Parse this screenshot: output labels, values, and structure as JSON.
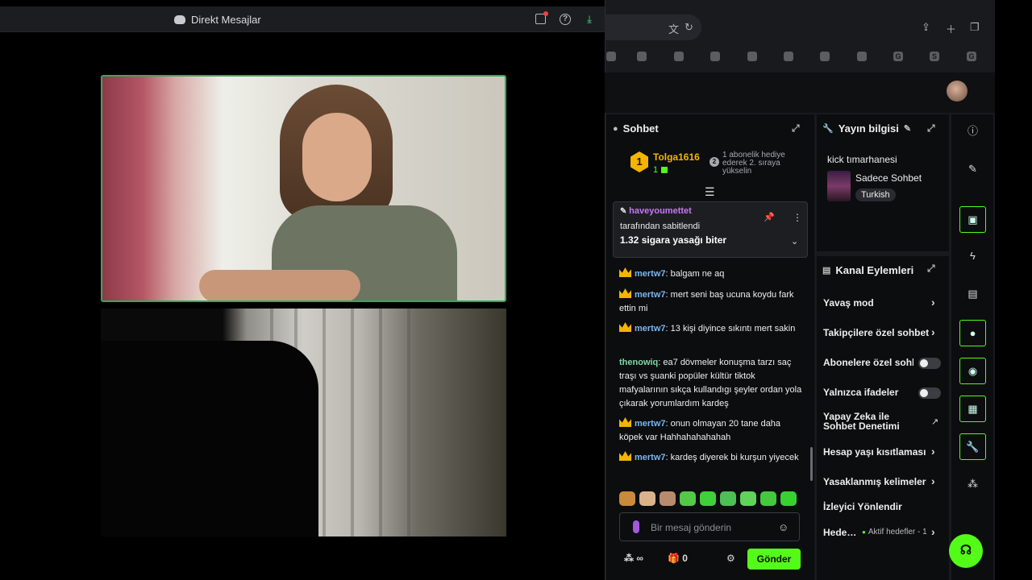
{
  "discord": {
    "window_title": "Direkt Mesajlar",
    "icons": [
      "discord-icon",
      "inbox-icon",
      "help-icon",
      "download-icon"
    ]
  },
  "browser": {
    "icons": [
      "translate-icon",
      "reload-icon",
      "share-icon",
      "new-tab-icon",
      "tabs-icon"
    ],
    "bookmarks": [
      "",
      "",
      "",
      "",
      "",
      "",
      "",
      "",
      "G",
      "S",
      "G"
    ]
  },
  "chat": {
    "header": "Sohbet",
    "leaderboard": {
      "rank": "1",
      "name": "Tolga1616",
      "count": "1",
      "next_badge": "2",
      "next_text": "1 abonelik hediye ederek 2. sıraya yükselin"
    },
    "pinned": {
      "user": "haveyoumettet",
      "subtitle": "tarafından sabitlendi",
      "message": "1.32 sigara yasağı biter"
    },
    "messages": [
      {
        "user": "mertw7",
        "text": "balgam ne aq",
        "crown": true
      },
      {
        "user": "mertw7",
        "text": "mert seni baş ucuna koydu fark ettin mi",
        "crown": true
      },
      {
        "user": "mertw7",
        "text": "13 kişi diyince sıkıntı mert sakin",
        "crown": true
      },
      {
        "user": "thenowiq",
        "text": "ea7 dövmeler konuşma tarzı saç traşı vs şuanki popüler kültür tiktok mafyalarının sıkça kullandıgı şeyler ordan yola çıkarak yorumlardım kardeş",
        "crown": false
      },
      {
        "user": "mertw7",
        "text": "onun olmayan 20 tane daha köpek var Hahhahahahahah",
        "crown": true
      },
      {
        "user": "mertw7",
        "text": "kardeş diyerek bi kurşun yiyecek",
        "crown": true
      }
    ],
    "input_placeholder": "Bir mesaj gönderin",
    "footer_infinity": "∞",
    "footer_count": "0",
    "send_label": "Gönder"
  },
  "stream_info": {
    "header": "Yayın bilgisi",
    "title": "kick tımarhanesi",
    "category": "Sadece Sohbet",
    "language": "Turkish"
  },
  "actions": {
    "header": "Kanal Eylemleri",
    "items": [
      {
        "label": "Yavaş mod",
        "control": "chevron"
      },
      {
        "label": "Takipçilere özel sohbet",
        "control": "chevron"
      },
      {
        "label": "Abonelere özel sohbet",
        "control": "toggle"
      },
      {
        "label": "Yalnızca ifadeler",
        "control": "toggle"
      },
      {
        "label": "Yapay Zeka ile Sohbet Denetimi",
        "control": "external"
      },
      {
        "label": "Hesap yaşı kısıtlaması",
        "control": "chevron"
      },
      {
        "label": "Yasaklanmış kelimeler",
        "control": "chevron"
      },
      {
        "label": "İzleyici Yönlendir",
        "control": "none"
      },
      {
        "label": "Hedefler",
        "control": "chevron"
      }
    ],
    "goals_status": "Aktif hedefler - 1"
  },
  "rail": {
    "icons": [
      "info-icon",
      "edit-icon",
      "screen-icon",
      "bolt-icon",
      "notes-icon",
      "chat-icon",
      "broadcast-icon",
      "layout-icon",
      "wrench-icon",
      "apps-icon"
    ]
  },
  "colors": {
    "kick_green": "#53fc18",
    "discord_green": "#3ba55c",
    "gold": "#f4b400"
  }
}
